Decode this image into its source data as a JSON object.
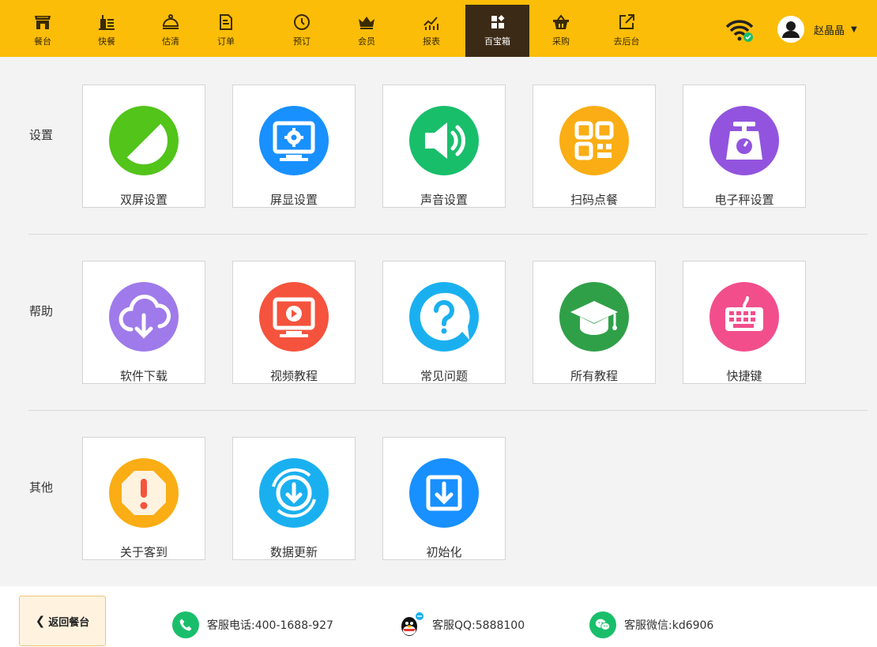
{
  "nav": {
    "items": [
      {
        "label": "餐台",
        "icon": "storefront-icon"
      },
      {
        "label": "快餐",
        "icon": "fast-food-icon"
      },
      {
        "label": "估清",
        "icon": "cloche-icon"
      },
      {
        "label": "订单",
        "icon": "order-doc-icon"
      },
      {
        "label": "预订",
        "icon": "clock-icon"
      },
      {
        "label": "会员",
        "icon": "crown-icon"
      },
      {
        "label": "报表",
        "icon": "chart-icon"
      },
      {
        "label": "百宝箱",
        "icon": "toolbox-grid-icon"
      },
      {
        "label": "采购",
        "icon": "basket-icon"
      },
      {
        "label": "去后台",
        "icon": "external-link-icon"
      }
    ],
    "active_index": 7,
    "username": "赵晶晶",
    "bar_color": "#fbbd08",
    "active_color": "#3b2a16"
  },
  "sections": [
    {
      "label": "设置",
      "tiles": [
        {
          "label": "双屏设置",
          "icon": "dual-screen-icon",
          "color": "#52c41a"
        },
        {
          "label": "屏显设置",
          "icon": "monitor-gear-icon",
          "color": "#1890ff"
        },
        {
          "label": "声音设置",
          "icon": "speaker-icon",
          "color": "#19be6b"
        },
        {
          "label": "扫码点餐",
          "icon": "qr-code-icon",
          "color": "#faad14"
        },
        {
          "label": "电子秤设置",
          "icon": "scale-icon",
          "color": "#9254de"
        }
      ]
    },
    {
      "label": "帮助",
      "tiles": [
        {
          "label": "软件下载",
          "icon": "cloud-download-icon",
          "color": "#9f7aea"
        },
        {
          "label": "视频教程",
          "icon": "video-screen-icon",
          "color": "#f5533d"
        },
        {
          "label": "常见问题",
          "icon": "question-bubble-icon",
          "color": "#1ab0f0"
        },
        {
          "label": "所有教程",
          "icon": "graduation-cap-icon",
          "color": "#2fa048"
        },
        {
          "label": "快捷键",
          "icon": "keyboard-icon",
          "color": "#f24e8c"
        }
      ]
    },
    {
      "label": "其他",
      "tiles": [
        {
          "label": "关于客到",
          "icon": "alert-octagon-icon",
          "color": "#faad14"
        },
        {
          "label": "数据更新",
          "icon": "refresh-download-icon",
          "color": "#1ab0f0"
        },
        {
          "label": "初始化",
          "icon": "download-box-icon",
          "color": "#1890ff"
        }
      ]
    }
  ],
  "footer": {
    "back_label": "返回餐台",
    "phone": "客服电话:400-1688-927",
    "qq": "客服QQ:5888100",
    "wechat": "客服微信:kd6906"
  }
}
